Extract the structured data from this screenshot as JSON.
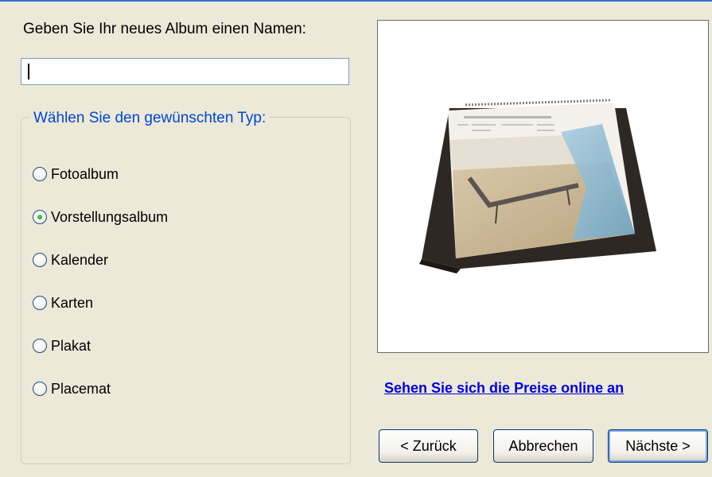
{
  "name_prompt": "Geben Sie Ihr neues Album einen Namen:",
  "name_input": {
    "value": "",
    "placeholder": ""
  },
  "type_group": {
    "legend": "Wählen Sie den gewünschten Typ:",
    "options": [
      {
        "label": "Fotoalbum",
        "checked": false
      },
      {
        "label": "Vorstellungsalbum",
        "checked": true
      },
      {
        "label": "Kalender",
        "checked": false
      },
      {
        "label": "Karten",
        "checked": false
      },
      {
        "label": "Plakat",
        "checked": false
      },
      {
        "label": "Placemat",
        "checked": false
      }
    ]
  },
  "price_link": "Sehen Sie sich die Preise online an",
  "buttons": {
    "back": "< Zurück",
    "cancel": "Abbrechen",
    "next": "Nächste >"
  },
  "colors": {
    "window_bg": "#ece9d8",
    "legend_text": "#0046d5",
    "link": "#0000e0",
    "radio_selected": "#21a121"
  }
}
